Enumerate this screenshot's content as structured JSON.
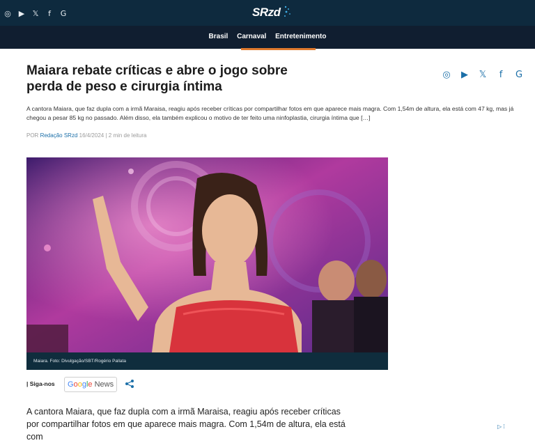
{
  "header": {
    "logo": "SRzd",
    "social_icons": [
      "instagram-icon",
      "youtube-icon",
      "x-icon",
      "facebook-icon",
      "google-icon"
    ],
    "social_glyphs": [
      "◎",
      "▶",
      "𝕏",
      "f",
      "G"
    ]
  },
  "nav": {
    "items": [
      "Brasil",
      "Carnaval",
      "Entretenimento"
    ],
    "accent_color": "#e07a2e"
  },
  "article": {
    "title": "Maiara rebate críticas e abre o jogo sobre perda de peso e cirurgia íntima",
    "lead": "A cantora Maiara, que faz dupla com a irmã Maraisa, reagiu após receber críticas por compartilhar fotos em que aparece mais magra. Com 1,54m de altura, ela está com 47 kg, mas já chegou a pesar 85 kg no passado. Além disso, ela também explicou o motivo de ter feito uma ninfoplastia, cirurgia íntima que […]",
    "byline": {
      "prefix": "POR",
      "author": "Redação SRzd",
      "date": "16/4/2024",
      "separator": "|",
      "read_time": "2 min de leitura"
    },
    "image_caption": "Maiara. Foto: Divulgação/SBT/Rogério Pallata",
    "follow_label": "| Siga-nos",
    "google_news": {
      "google": "Google",
      "news": "News"
    },
    "body_text": "A cantora Maiara, que faz dupla com a irmã Maraisa, reagiu após receber críticas por compartilhar fotos em que aparece mais magra. Com 1,54m de altura, ela está com"
  },
  "ad_marker": "▷ ⁞"
}
